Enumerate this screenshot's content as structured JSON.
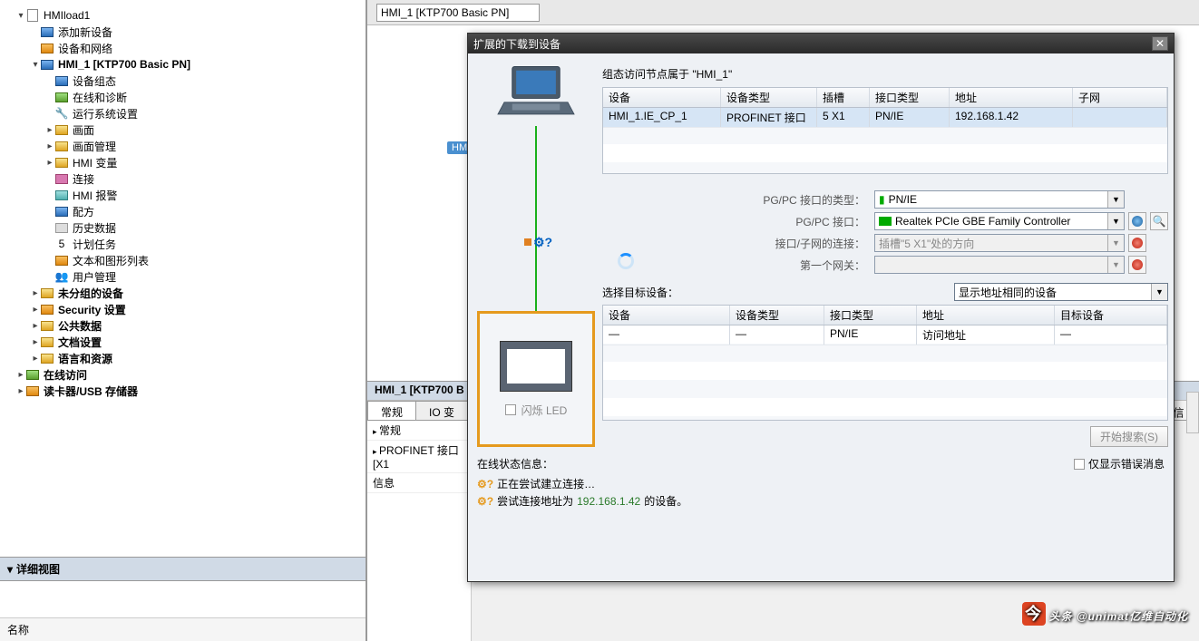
{
  "tree": {
    "project": "HMIload1",
    "add_device": "添加新设备",
    "dev_net": "设备和网络",
    "hmi_node": "HMI_1 [KTP700 Basic PN]",
    "dev_config": "设备组态",
    "online_diag": "在线和诊断",
    "runtime_set": "运行系统设置",
    "screens": "画面",
    "screen_mgmt": "画面管理",
    "hmi_vars": "HMI 变量",
    "connections": "连接",
    "hmi_alarm": "HMI 报警",
    "recipe": "配方",
    "history": "历史数据",
    "schedule": "计划任务",
    "text_graphic": "文本和图形列表",
    "user_mgmt": "用户管理",
    "ungrouped": "未分组的设备",
    "security": "Security 设置",
    "public_data": "公共数据",
    "doc_settings": "文档设置",
    "lang_res": "语言和资源",
    "online_access": "在线访问",
    "card_usb": "读卡器/USB 存储器"
  },
  "detail_view": "详细视图",
  "name_col": "名称",
  "device_badge": "HM",
  "right_tab": "HMI_1 [KTP700 Basic PN]",
  "prop_title": "HMI_1 [KTP700 B",
  "prop_tabs": {
    "general": "常规",
    "iovar": "IO 变"
  },
  "prop_items": {
    "general": "常规",
    "profinet": "PROFINET 接口 [X1",
    "info": "信息"
  },
  "dialog": {
    "title": "扩展的下载到设备",
    "access_label": "组态访问节点属于 \"HMI_1\"",
    "grid1": {
      "cols": {
        "device": "设备",
        "dev_type": "设备类型",
        "slot": "插槽",
        "ifc_type": "接口类型",
        "addr": "地址",
        "subnet": "子网"
      },
      "row": {
        "device": "HMI_1.IE_CP_1",
        "dev_type": "PROFINET 接口",
        "slot": "5 X1",
        "ifc_type": "PN/IE",
        "addr": "192.168.1.42",
        "subnet": ""
      }
    },
    "form": {
      "ifc_type_lbl": "PG/PC 接口的类型：",
      "ifc_type_val": "PN/IE",
      "ifc_lbl": "PG/PC 接口：",
      "ifc_val": "Realtek PCIe GBE Family Controller",
      "conn_lbl": "接口/子网的连接：",
      "conn_val": "插槽\"5 X1\"处的方向",
      "gw_lbl": "第一个网关：",
      "gw_val": ""
    },
    "target_lbl": "选择目标设备：",
    "target_val": "显示地址相同的设备",
    "grid2": {
      "cols": {
        "device": "设备",
        "dev_type": "设备类型",
        "ifc_type": "接口类型",
        "addr": "地址",
        "target": "目标设备"
      },
      "row": {
        "device": "—",
        "dev_type": "—",
        "ifc_type": "PN/IE",
        "addr": "访问地址",
        "target": "—"
      }
    },
    "led_label": "闪烁 LED",
    "search_btn": "开始搜索(S)",
    "log_title": "在线状态信息：",
    "log_chk": "仅显示错误消息",
    "log1": "正在尝试建立连接…",
    "log2a": "尝试连接地址为 ",
    "log2b": "192.168.1.42",
    "log2c": " 的设备。"
  },
  "right_gutter": "信",
  "watermark": "头条 @unimat亿维自动化"
}
